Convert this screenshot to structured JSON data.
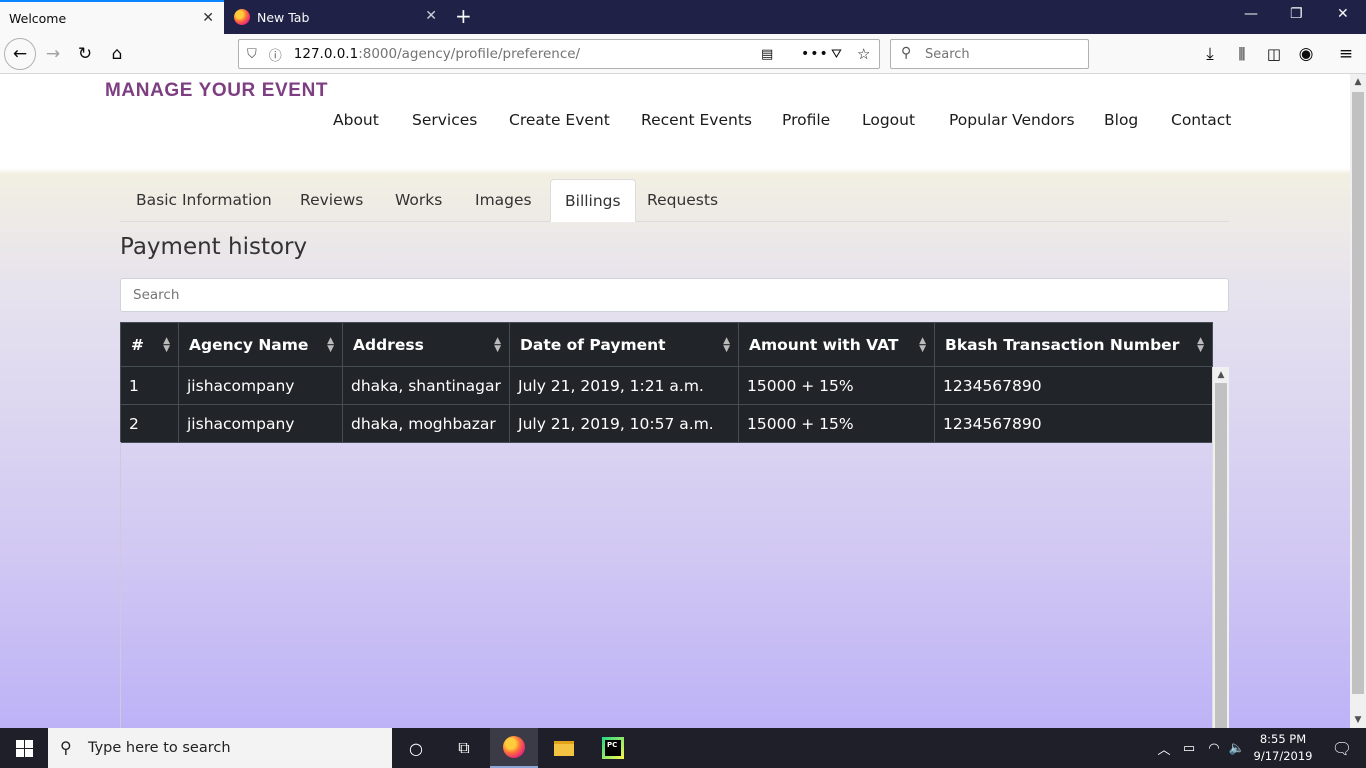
{
  "browser": {
    "tabs": [
      {
        "title": "Welcome",
        "active": true
      },
      {
        "title": "New Tab",
        "active": false
      }
    ],
    "url_host": "127.0.0.1",
    "url_path": ":8000/agency/profile/preference/",
    "search_placeholder": "Search"
  },
  "site": {
    "brand": "MANAGE YOUR EVENT",
    "menu": [
      "About",
      "Services",
      "Create Event",
      "Recent Events",
      "Profile",
      "Logout",
      "Popular Vendors",
      "Blog",
      "Contact"
    ]
  },
  "profile_tabs": {
    "items": [
      "Basic Information",
      "Reviews",
      "Works",
      "Images",
      "Billings",
      "Requests"
    ],
    "active": "Billings"
  },
  "billing": {
    "heading": "Payment history",
    "search_placeholder": "Search",
    "columns": [
      "#",
      "Agency Name",
      "Address",
      "Date of Payment",
      "Amount with VAT",
      "Bkash Transaction Number"
    ],
    "rows": [
      [
        "1",
        "jishacompany",
        "dhaka, shantinagar",
        "July 21, 2019, 1:21 a.m.",
        "15000 + 15%",
        "1234567890"
      ],
      [
        "2",
        "jishacompany",
        "dhaka, moghbazar",
        "July 21, 2019, 10:57 a.m.",
        "15000 + 15%",
        "1234567890"
      ]
    ]
  },
  "taskbar": {
    "search_placeholder": "Type here to search",
    "time": "8:55 PM",
    "date": "9/17/2019"
  },
  "icons": [
    "windows-logo-icon",
    "search-icon",
    "cortana-icon",
    "task-view-icon",
    "firefox-icon",
    "file-explorer-icon",
    "pycharm-icon",
    "tray-chevron-icon",
    "battery-icon",
    "wifi-icon",
    "volume-icon",
    "notification-icon"
  ]
}
